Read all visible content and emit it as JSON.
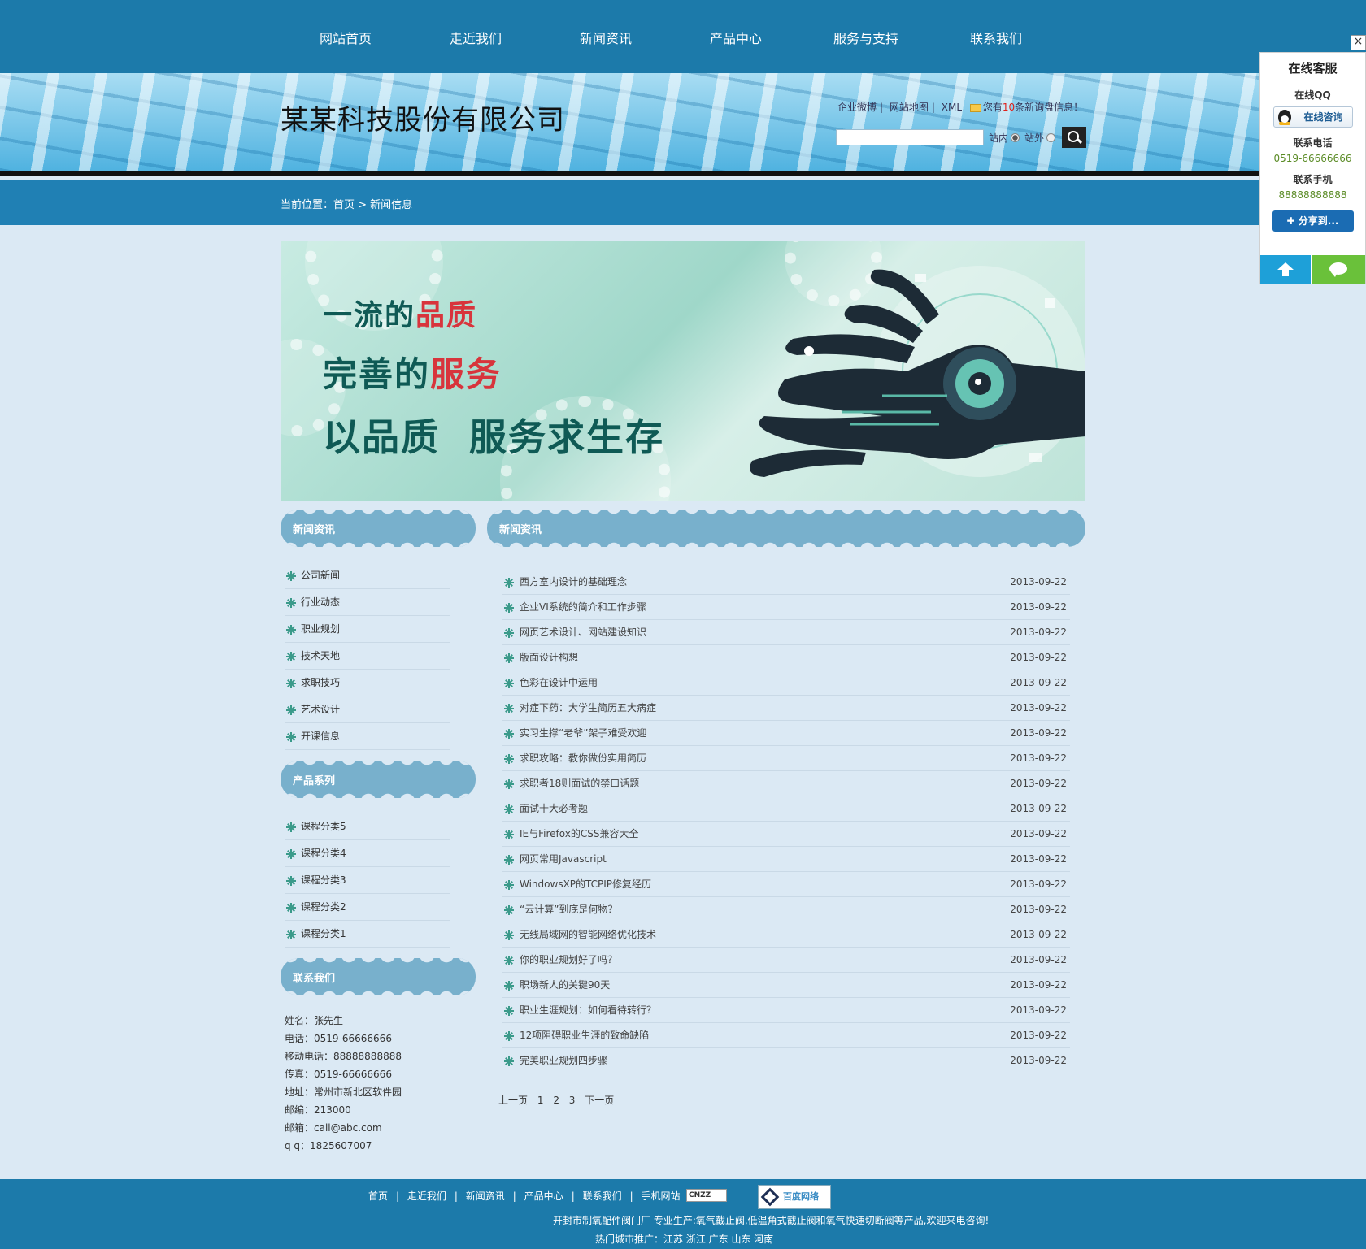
{
  "nav": {
    "items": [
      "网站首页",
      "走近我们",
      "新闻资讯",
      "产品中心",
      "服务与支持",
      "联系我们"
    ]
  },
  "header": {
    "company_name": "某某科技股份有限公司",
    "links": {
      "weibo": "企业微博",
      "sitemap": "网站地图",
      "xml": "XML",
      "inbox_prefix": "您有",
      "inbox_count": "10",
      "inbox_suffix": "条新询盘信息！"
    },
    "search": {
      "placeholder": "",
      "inside_label": "站内",
      "outside_label": "站外"
    }
  },
  "breadcrumb": {
    "text": "当前位置：首页 > 新闻信息"
  },
  "banner": {
    "line1_a": "一流的",
    "line1_b": "品质",
    "line2_a": "完善的",
    "line2_b": "服务",
    "line3": "以品质  服务求生存"
  },
  "sidebar": {
    "news_title": "新闻资讯",
    "news_items": [
      "公司新闻",
      "行业动态",
      "职业规划",
      "技术天地",
      "求职技巧",
      "艺术设计",
      "开课信息"
    ],
    "products_title": "产品系列",
    "product_items": [
      "课程分类5",
      "课程分类4",
      "课程分类3",
      "课程分类2",
      "课程分类1"
    ],
    "contact_title": "联系我们",
    "contact_lines": [
      "姓名：张先生",
      "电话：0519-66666666",
      "移动电话：88888888888",
      "传真：0519-66666666",
      "地址：常州市新北区软件园",
      "邮编：213000",
      "邮箱：call@abc.com",
      "q q：1825607007"
    ]
  },
  "main": {
    "title": "新闻资讯",
    "news": [
      {
        "title": "西方室内设计的基础理念",
        "date": "2013-09-22"
      },
      {
        "title": "企业VI系统的简介和工作步骤",
        "date": "2013-09-22"
      },
      {
        "title": "网页艺术设计、网站建设知识",
        "date": "2013-09-22"
      },
      {
        "title": "版面设计构想",
        "date": "2013-09-22"
      },
      {
        "title": "色彩在设计中运用",
        "date": "2013-09-22"
      },
      {
        "title": "对症下药：大学生简历五大病症",
        "date": "2013-09-22"
      },
      {
        "title": "实习生撑“老爷”架子难受欢迎",
        "date": "2013-09-22"
      },
      {
        "title": "求职攻略：教你做份实用简历",
        "date": "2013-09-22"
      },
      {
        "title": "求职者18则面试的禁口话题",
        "date": "2013-09-22"
      },
      {
        "title": "面试十大必考题",
        "date": "2013-09-22"
      },
      {
        "title": "IE与Firefox的CSS兼容大全",
        "date": "2013-09-22"
      },
      {
        "title": "网页常用Javascript",
        "date": "2013-09-22"
      },
      {
        "title": "WindowsXP的TCPIP修复经历",
        "date": "2013-09-22"
      },
      {
        "title": "“云计算”到底是何物？",
        "date": "2013-09-22"
      },
      {
        "title": "无线局域网的智能网络优化技术",
        "date": "2013-09-22"
      },
      {
        "title": "你的职业规划好了吗？",
        "date": "2013-09-22"
      },
      {
        "title": "职场新人的关键90天",
        "date": "2013-09-22"
      },
      {
        "title": "职业生涯规划：如何看待转行？",
        "date": "2013-09-22"
      },
      {
        "title": "12项阻碍职业生涯的致命缺陷",
        "date": "2013-09-22"
      },
      {
        "title": "完美职业规划四步骤",
        "date": "2013-09-22"
      }
    ],
    "pager": {
      "prev": "上一页",
      "pages": [
        "1",
        "2",
        "3"
      ],
      "next": "下一页"
    }
  },
  "footer": {
    "links": [
      "首页",
      "走近我们",
      "新闻资讯",
      "产品中心",
      "联系我们",
      "手机网站"
    ],
    "cnzz": "CNZZ",
    "badge": "百度网络",
    "line2": "开封市制氧配件阀门厂 专业生产:氧气截止阀,低温角式截止阀和氧气快速切断阀等产品,欢迎来电咨询!",
    "line3": "热门城市推广：江苏 浙江 广东 山东 河南"
  },
  "service_panel": {
    "close": "×",
    "title": "在线客服",
    "qq_label": "在线QQ",
    "qq_button": "在线咨询",
    "phone_label": "联系电话",
    "phone_value": "0519-66666666",
    "mobile_label": "联系手机",
    "mobile_value": "88888888888",
    "share_button": "✚ 分享到..."
  }
}
